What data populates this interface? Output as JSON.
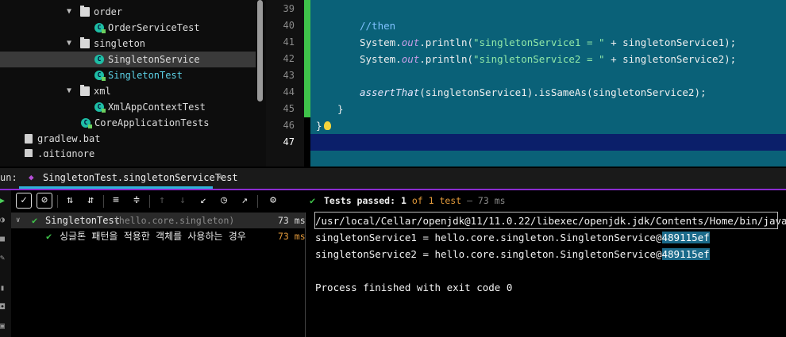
{
  "project_tree": {
    "items": [
      {
        "label": "order",
        "kind": "folder",
        "expanded": true
      },
      {
        "label": "OrderServiceTest",
        "kind": "test-class"
      },
      {
        "label": "singleton",
        "kind": "folder",
        "expanded": true
      },
      {
        "label": "SingletonService",
        "kind": "class",
        "selected": true
      },
      {
        "label": "SingletonTest",
        "kind": "test-class"
      },
      {
        "label": "xml",
        "kind": "folder",
        "expanded": true
      },
      {
        "label": "XmlAppContextTest",
        "kind": "test-class"
      },
      {
        "label": "CoreApplicationTests",
        "kind": "test-class"
      },
      {
        "label": "gradlew.bat",
        "kind": "file"
      },
      {
        "label": ".gitignore",
        "kind": "file"
      }
    ]
  },
  "editor": {
    "line_numbers": [
      "39",
      "40",
      "41",
      "42",
      "43",
      "44",
      "45",
      "46",
      "47"
    ],
    "current_line": "47",
    "lines": {
      "l40_comment": "//then",
      "l41_prefix": "System.",
      "l41_field": "out",
      "l41_call": ".println(",
      "l41_string": "\"singletonService1 = \"",
      "l41_suffix": " + singletonService1);",
      "l42_prefix": "System.",
      "l42_field": "out",
      "l42_call": ".println(",
      "l42_string": "\"singletonService2 = \"",
      "l42_suffix": " + singletonService2);",
      "l44_method": "assertThat",
      "l44_rest": "(singletonService1).isSameAs(singletonService2);",
      "l45": "}",
      "l46": "}"
    }
  },
  "run_panel": {
    "label": "un:",
    "tab_title": "SingletonTest.singletonServiceTest",
    "status": {
      "prefix": "Tests passed:",
      "passed": "1",
      "of_text": "of 1 test",
      "duration": "– 73 ms"
    },
    "results": {
      "suite_name": "SingletonTest",
      "suite_package": "(hello.core.singleton)",
      "suite_time": "73 ms",
      "test_name": "싱글톤 패턴을 적용한 객체를 사용하는 경우",
      "test_time": "73 ms"
    },
    "console": {
      "command": "/usr/local/Cellar/openjdk@11/11.0.22/libexec/openjdk.jdk/Contents/Home/bin/java ...",
      "line1_prefix": "singletonService1 = hello.core.singleton.SingletonService@",
      "line1_hash": "489115ef",
      "line2_prefix": "singletonService2 = hello.core.singleton.SingletonService@",
      "line2_hash": "489115ef",
      "exit": "Process finished with exit code 0"
    }
  },
  "colors": {
    "editor_bg": "#0a6178",
    "current_line": "#0b1f6a",
    "accent_purple": "#8a2bd0",
    "pass_green": "#3fc34a",
    "time_orange": "#e39a3b"
  }
}
